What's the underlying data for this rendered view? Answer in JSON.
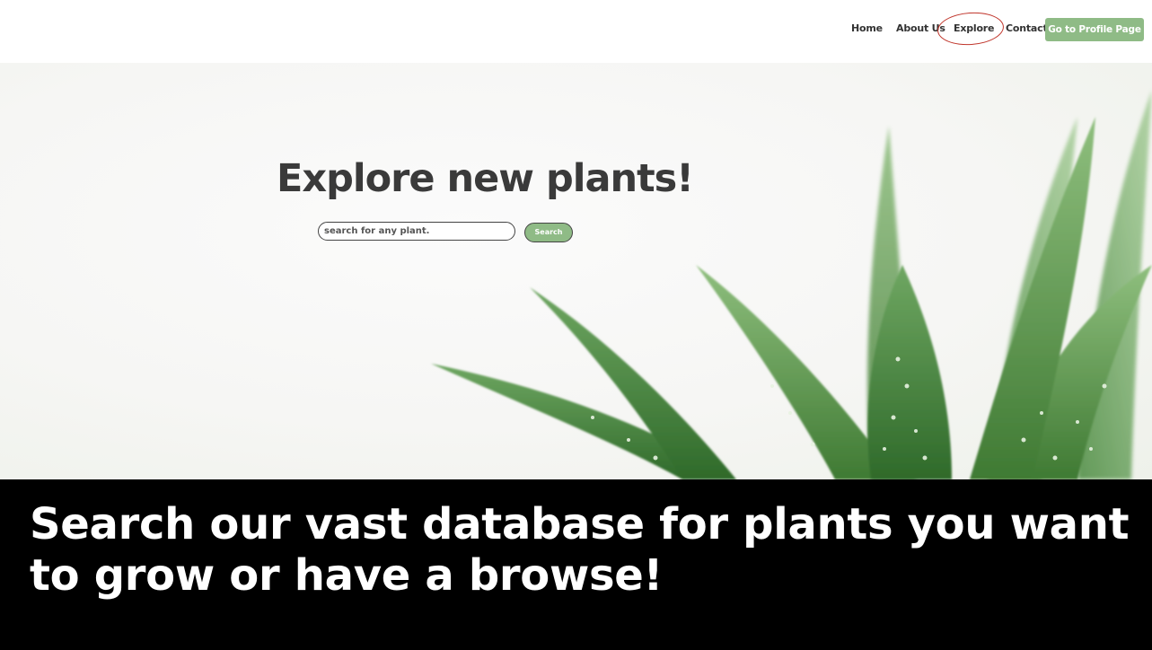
{
  "nav": {
    "home": "Home",
    "about": "About Us",
    "explore": "Explore",
    "contact": "Contact",
    "profile_button": "Go to Profile Page"
  },
  "hero": {
    "title": "Explore new plants!",
    "search_placeholder": "search for any plant.",
    "search_button": "Search"
  },
  "caption": {
    "text": "Search our vast database for plants you want to grow or have a browse!"
  },
  "colors": {
    "accent_green": "#8fbb86",
    "annotation_red": "#c0352b",
    "caption_bg": "#000000"
  }
}
